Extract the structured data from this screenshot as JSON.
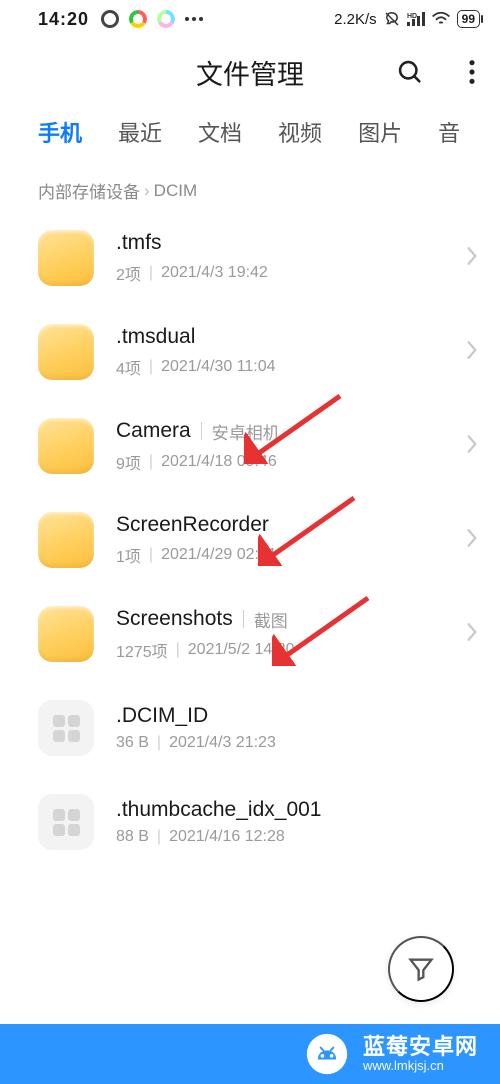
{
  "status": {
    "time": "14:20",
    "net_speed": "2.2K/s",
    "hd_label": "HD",
    "battery": "99"
  },
  "header": {
    "title": "文件管理"
  },
  "tabs": [
    {
      "label": "手机",
      "active": true
    },
    {
      "label": "最近",
      "active": false
    },
    {
      "label": "文档",
      "active": false
    },
    {
      "label": "视频",
      "active": false
    },
    {
      "label": "图片",
      "active": false
    },
    {
      "label": "音",
      "active": false
    }
  ],
  "breadcrumb": {
    "root": "内部存储设备",
    "current": "DCIM"
  },
  "items": [
    {
      "type": "folder",
      "name": ".tmfs",
      "alias": "",
      "count": "2项",
      "date": "2021/4/3 19:42",
      "arrow": false
    },
    {
      "type": "folder",
      "name": ".tmsdual",
      "alias": "",
      "count": "4项",
      "date": "2021/4/30 11:04",
      "arrow": false
    },
    {
      "type": "folder",
      "name": "Camera",
      "alias": "安卓相机",
      "count": "9项",
      "date": "2021/4/18 09:46",
      "arrow": true
    },
    {
      "type": "folder",
      "name": "ScreenRecorder",
      "alias": "",
      "count": "1项",
      "date": "2021/4/29 02:51",
      "arrow": true
    },
    {
      "type": "folder",
      "name": "Screenshots",
      "alias": "截图",
      "count": "1275项",
      "date": "2021/5/2 14:20",
      "arrow": true
    },
    {
      "type": "file",
      "name": ".DCIM_ID",
      "alias": "",
      "count": "36 B",
      "date": "2021/4/3 21:23",
      "arrow": false
    },
    {
      "type": "file",
      "name": ".thumbcache_idx_001",
      "alias": "",
      "count": "88 B",
      "date": "2021/4/16 12:28",
      "arrow": false
    }
  ],
  "watermark": {
    "title": "蓝莓安卓网",
    "url": "www.lmkjsj.cn"
  },
  "colors": {
    "accent": "#0a7cff",
    "folder_gradient_top": "#ffe39a",
    "folder_gradient_bottom": "#fcbf3b",
    "arrow": "#e63232"
  }
}
